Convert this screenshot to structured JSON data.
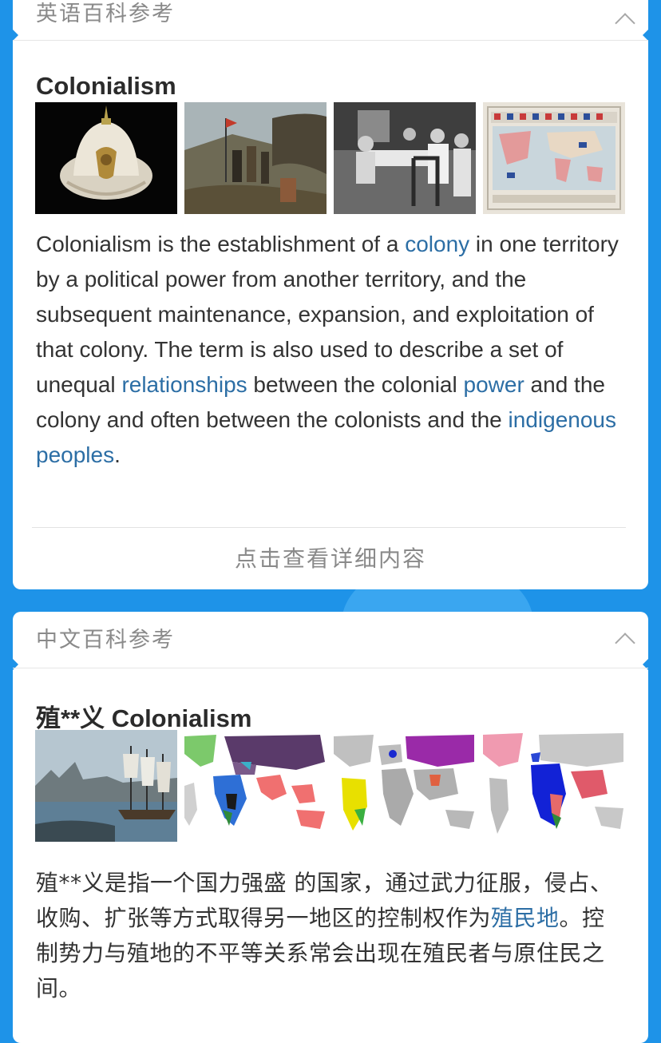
{
  "english_card": {
    "header_title": "英语百科参考",
    "entry_title": "Colonialism",
    "paragraph": [
      {
        "text": "Colonialism is the establishment of a ",
        "link": false
      },
      {
        "text": "colony",
        "link": true
      },
      {
        "text": " in one territory by a political power from another territory, and the subsequent maintenance, expansion, and exploitation of that colony. The term is also used to describe a set of unequal ",
        "link": false
      },
      {
        "text": "relationships",
        "link": true
      },
      {
        "text": " between the colonial ",
        "link": false
      },
      {
        "text": "power",
        "link": true
      },
      {
        "text": " and the colony and often between the colonists and the ",
        "link": false
      },
      {
        "text": "indigenous peoples",
        "link": true
      },
      {
        "text": ".",
        "link": false
      }
    ],
    "more_label": "点击查看详细内容"
  },
  "chinese_card": {
    "header_title": "中文百科参考",
    "entry_title": "殖**义 Colonialism",
    "paragraph": [
      {
        "text": "殖**义是指一个国力强盛 的国家，通过武力征服，侵占、收购、扩张等方式取得另一地区的控制权作为",
        "link": false
      },
      {
        "text": "殖民地",
        "link": true
      },
      {
        "text": "。控制势力与殖地的不平等关系常会出现在殖民者与原住民之间。",
        "link": false
      }
    ]
  },
  "colors": {
    "background": "#1e93e8",
    "link": "#2c6ea5",
    "header_text": "#8a8a8a"
  }
}
